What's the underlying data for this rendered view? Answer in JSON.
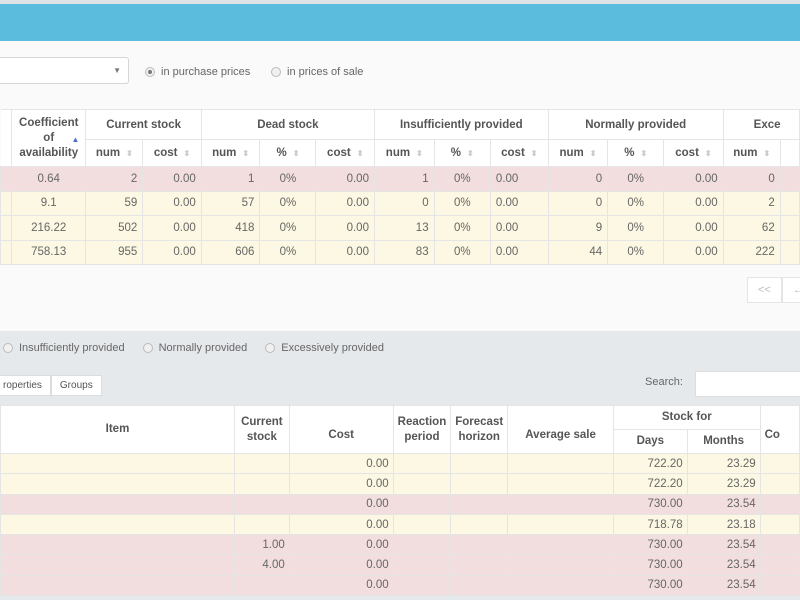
{
  "header": {
    "color": "#5bbcdd"
  },
  "controls": {
    "select_value": "",
    "price_mode": [
      {
        "label": "in purchase prices",
        "selected": true
      },
      {
        "label": "in prices of sale",
        "selected": false
      }
    ]
  },
  "summary_table": {
    "group_headers": [
      "Coefficient of availability",
      "Current stock",
      "Dead stock",
      "Insufficiently provided",
      "Normally provided",
      "Exce"
    ],
    "sub_headers": {
      "current_stock": [
        "num",
        "cost"
      ],
      "dead_stock": [
        "num",
        "%",
        "cost"
      ],
      "insufficiently": [
        "num",
        "%",
        "cost"
      ],
      "normally": [
        "num",
        "%",
        "cost"
      ],
      "excessively": [
        "num"
      ]
    },
    "rows": [
      {
        "status": "red",
        "coef": "0.64",
        "cur_num": "2",
        "cur_cost": "0.00",
        "dead_num": "1",
        "dead_pct": "0%",
        "dead_cost": "0.00",
        "ins_num": "1",
        "ins_pct": "0%",
        "ins_cost": "0.00",
        "norm_num": "0",
        "norm_pct": "0%",
        "norm_cost": "0.00",
        "exc_num": "0"
      },
      {
        "status": "yellow",
        "coef": "9.1",
        "cur_num": "59",
        "cur_cost": "0.00",
        "dead_num": "57",
        "dead_pct": "0%",
        "dead_cost": "0.00",
        "ins_num": "0",
        "ins_pct": "0%",
        "ins_cost": "0.00",
        "norm_num": "0",
        "norm_pct": "0%",
        "norm_cost": "0.00",
        "exc_num": "2"
      },
      {
        "status": "yellow",
        "coef": "216.22",
        "cur_num": "502",
        "cur_cost": "0.00",
        "dead_num": "418",
        "dead_pct": "0%",
        "dead_cost": "0.00",
        "ins_num": "13",
        "ins_pct": "0%",
        "ins_cost": "0.00",
        "norm_num": "9",
        "norm_pct": "0%",
        "norm_cost": "0.00",
        "exc_num": "62"
      },
      {
        "status": "yellow",
        "coef": "758.13",
        "cur_num": "955",
        "cur_cost": "0.00",
        "dead_num": "606",
        "dead_pct": "0%",
        "dead_cost": "0.00",
        "ins_num": "83",
        "ins_pct": "0%",
        "ins_cost": "0.00",
        "norm_num": "44",
        "norm_pct": "0%",
        "norm_cost": "0.00",
        "exc_num": "222"
      }
    ]
  },
  "pagination": {
    "first": "<<",
    "prev": "←"
  },
  "filters": [
    {
      "label": "Insufficiently provided",
      "selected": false
    },
    {
      "label": "Normally provided",
      "selected": false
    },
    {
      "label": "Excessively provided",
      "selected": false
    }
  ],
  "tabs": [
    "roperties",
    "Groups"
  ],
  "search": {
    "label": "Search:",
    "value": ""
  },
  "items_table": {
    "headers": {
      "item": "Item",
      "current_stock": "Current stock",
      "cost": "Cost",
      "reaction_period": "Reaction period",
      "forecast_horizon": "Forecast horizon",
      "average_sale": "Average sale",
      "stock_for": "Stock for",
      "days": "Days",
      "months": "Months",
      "next": "Co"
    },
    "rows": [
      {
        "status": "yellow",
        "item": "",
        "current_stock": "",
        "cost": "0.00",
        "reaction": "",
        "forecast": "",
        "avg_sale": "",
        "days": "722.20",
        "months": "23.29"
      },
      {
        "status": "yellow",
        "item": "",
        "current_stock": "",
        "cost": "0.00",
        "reaction": "",
        "forecast": "",
        "avg_sale": "",
        "days": "722.20",
        "months": "23.29"
      },
      {
        "status": "red",
        "item": "",
        "current_stock": "",
        "cost": "0.00",
        "reaction": "",
        "forecast": "",
        "avg_sale": "",
        "days": "730.00",
        "months": "23.54"
      },
      {
        "status": "yellow",
        "item": "",
        "current_stock": "",
        "cost": "0.00",
        "reaction": "",
        "forecast": "",
        "avg_sale": "",
        "days": "718.78",
        "months": "23.18"
      },
      {
        "status": "red",
        "item": "",
        "current_stock": "1.00",
        "cost": "0.00",
        "reaction": "",
        "forecast": "",
        "avg_sale": "",
        "days": "730.00",
        "months": "23.54"
      },
      {
        "status": "red",
        "item": "",
        "current_stock": "4.00",
        "cost": "0.00",
        "reaction": "",
        "forecast": "",
        "avg_sale": "",
        "days": "730.00",
        "months": "23.54"
      },
      {
        "status": "red",
        "item": "",
        "current_stock": "",
        "cost": "0.00",
        "reaction": "",
        "forecast": "",
        "avg_sale": "",
        "days": "730.00",
        "months": "23.54"
      }
    ]
  }
}
